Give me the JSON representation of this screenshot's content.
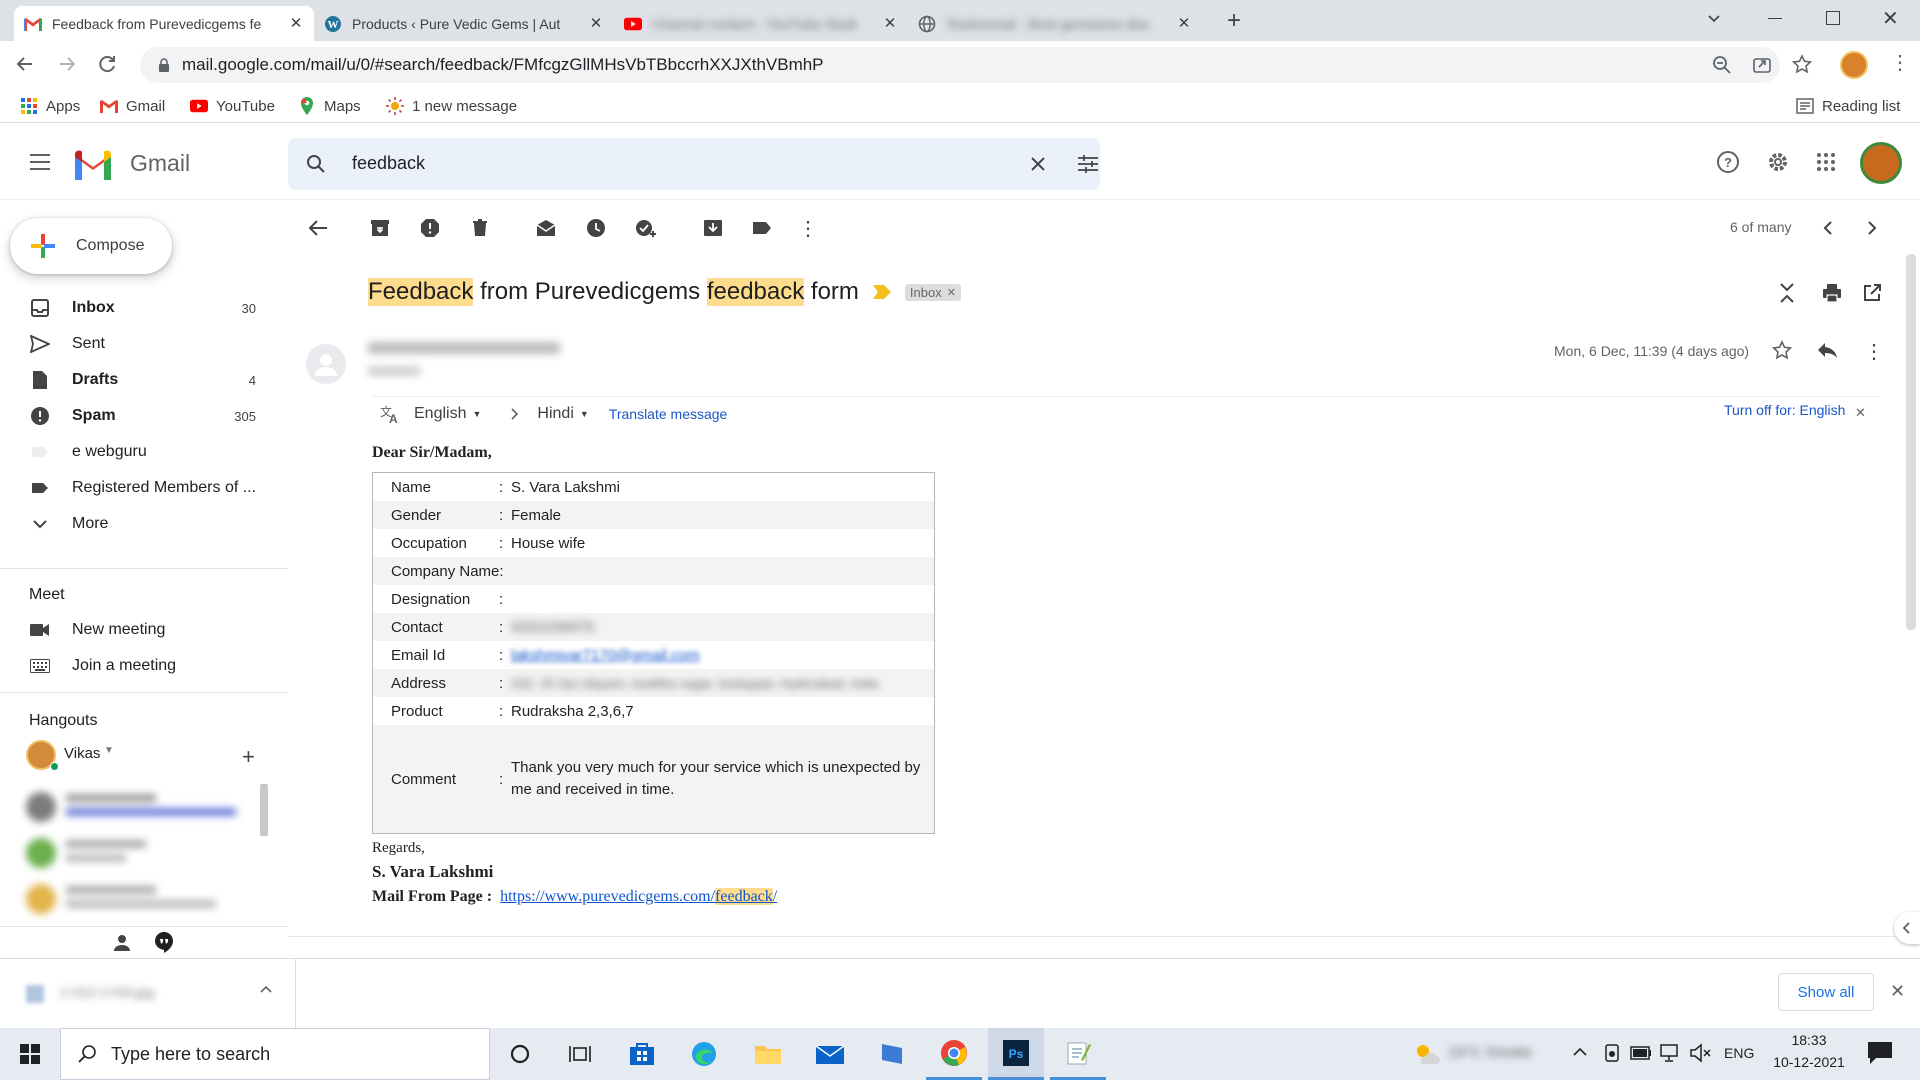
{
  "browser": {
    "tabs": [
      {
        "title": "Feedback from Purevedicgems fe",
        "icon": "gmail-icon",
        "active": true
      },
      {
        "title": "Products ‹ Pure Vedic Gems | Aut",
        "icon": "wordpress-icon",
        "active": false
      },
      {
        "title": "Channel content - YouTube Studi",
        "icon": "youtube-icon",
        "active": false
      },
      {
        "title": "Testimonial - Best gemstone dea",
        "icon": "globe-icon",
        "active": false
      }
    ],
    "url": "mail.google.com/mail/u/0/#search/feedback/FMfcgzGllMHsVbTBbccrhXXJXthVBmhP",
    "bookmarks": [
      {
        "label": "Apps",
        "icon": "apps-grid-icon"
      },
      {
        "label": "Gmail",
        "icon": "gmail-icon"
      },
      {
        "label": "YouTube",
        "icon": "youtube-icon"
      },
      {
        "label": "Maps",
        "icon": "maps-icon"
      },
      {
        "label": "1 new message",
        "icon": "notification-icon"
      }
    ],
    "reading_list": "Reading list"
  },
  "gmail": {
    "logo_text": "Gmail",
    "search_query": "feedback",
    "compose": "Compose",
    "nav": [
      {
        "label": "Inbox",
        "count": "30",
        "bold": true,
        "icon": "inbox-icon"
      },
      {
        "label": "Sent",
        "count": "",
        "bold": false,
        "icon": "send-icon"
      },
      {
        "label": "Drafts",
        "count": "4",
        "bold": true,
        "icon": "draft-icon"
      },
      {
        "label": "Spam",
        "count": "305",
        "bold": true,
        "icon": "spam-icon"
      },
      {
        "label": "e webguru",
        "count": "",
        "bold": false,
        "icon": "label-icon"
      },
      {
        "label": "Registered Members of ...",
        "count": "",
        "bold": false,
        "icon": "label-icon"
      },
      {
        "label": "More",
        "count": "",
        "bold": false,
        "icon": "chevron-down-icon"
      }
    ],
    "meet": {
      "title": "Meet",
      "new_meeting": "New meeting",
      "join": "Join a meeting"
    },
    "hangouts": {
      "title": "Hangouts",
      "user": "Vikas"
    },
    "pagination": "6 of many"
  },
  "message": {
    "subject_parts": [
      "Feedback",
      " from Purevedicgems ",
      "feedback",
      " form"
    ],
    "label": "Inbox",
    "date": "Mon, 6 Dec, 11:39 (4 days ago)",
    "translate": {
      "from": "English",
      "to": "Hindi",
      "action": "Translate message",
      "turn_off": "Turn off for: English"
    },
    "greeting": "Dear Sir/Madam,",
    "fields": [
      {
        "label": "Name",
        "colon": ":",
        "value": "S. Vara Lakshmi"
      },
      {
        "label": "Gender",
        "colon": ":",
        "value": "Female"
      },
      {
        "label": "Occupation",
        "colon": ":",
        "value": "House wife"
      },
      {
        "label": "Company Name:",
        "colon": "",
        "value": ""
      },
      {
        "label": "Designation",
        "colon": ":",
        "value": ""
      },
      {
        "label": "Contact",
        "colon": ":",
        "value": "9331039975"
      },
      {
        "label": "Email Id",
        "colon": ":",
        "value": "lakshmivar7170@gmail.com"
      },
      {
        "label": "Address",
        "colon": ":",
        "value": "202, 33 Sai nilayam, buddha nagar, boduppal, Hyderabad, India"
      },
      {
        "label": "Product",
        "colon": ":",
        "value": "Rudraksha 2,3,6,7"
      },
      {
        "label": "Comment",
        "colon": ":",
        "value": "Thank you very much for your service which is unexpected by me and received in time."
      }
    ],
    "regards": "Regards,",
    "signature": "S. Vara Lakshmi",
    "mail_from_label": "Mail From Page :",
    "mail_from_link_prefix": "https://www.purevedicgems.com/",
    "mail_from_link_hl": "feedback",
    "mail_from_link_suffix": "/"
  },
  "download_bar": {
    "file": "1-012-1749.jpg",
    "show_all": "Show all"
  },
  "taskbar": {
    "search_placeholder": "Type here to search",
    "weather": "19°C Smoke",
    "lang": "ENG",
    "time": "18:33",
    "date": "10-12-2021"
  }
}
